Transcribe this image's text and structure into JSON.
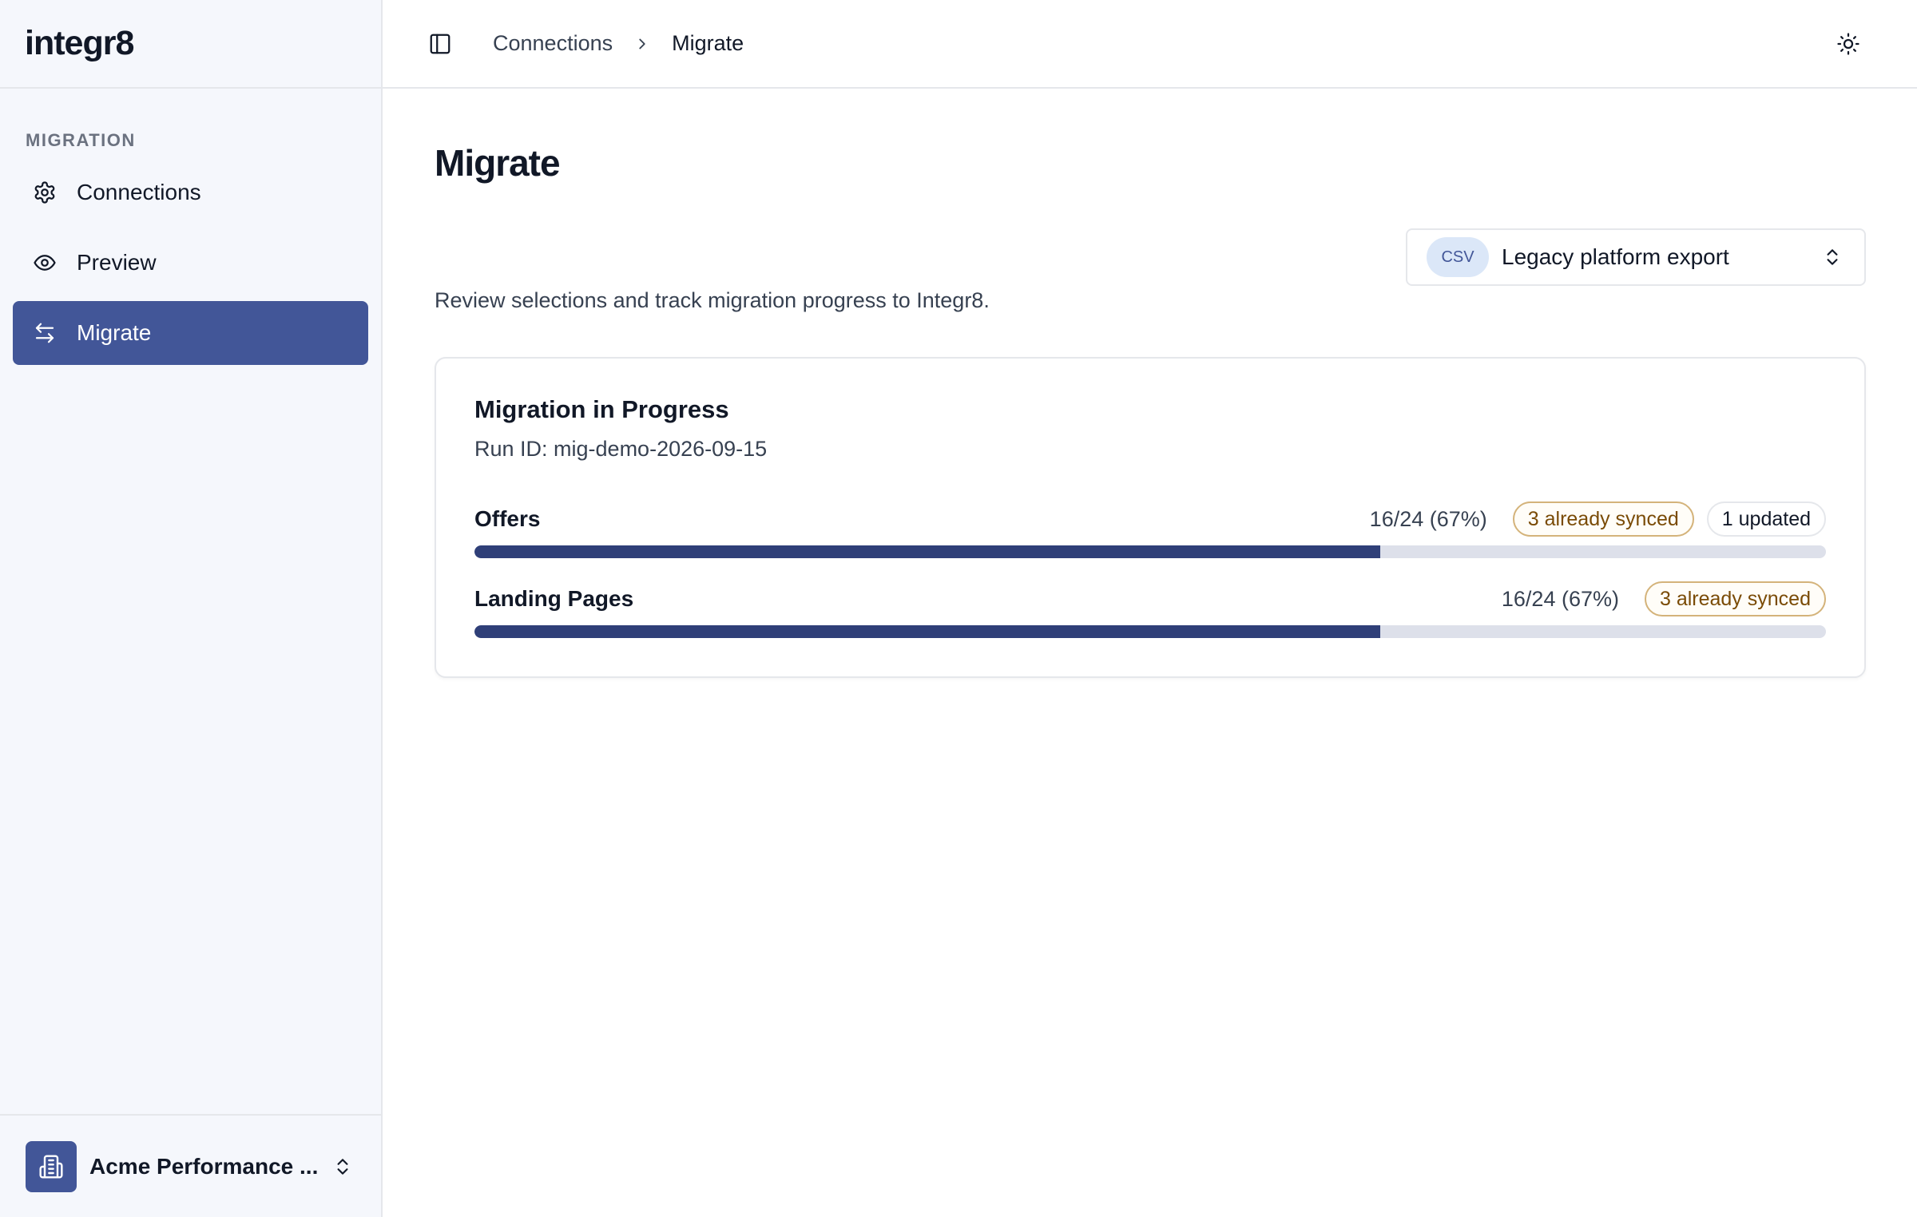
{
  "brand": {
    "logo": "integr8"
  },
  "sidebar": {
    "section_label": "MIGRATION",
    "items": [
      {
        "label": "Connections",
        "icon": "gear-icon",
        "active": false
      },
      {
        "label": "Preview",
        "icon": "eye-icon",
        "active": false
      },
      {
        "label": "Migrate",
        "icon": "arrows-left-right-icon",
        "active": true
      }
    ],
    "org": {
      "name": "Acme Performance ...",
      "icon": "building-icon"
    }
  },
  "topbar": {
    "breadcrumb": [
      "Connections",
      "Migrate"
    ],
    "theme_icon": "sun-icon",
    "panel_icon": "sidebar-panel-icon"
  },
  "page": {
    "title": "Migrate",
    "subtitle": "Review selections and track migration progress to Integr8."
  },
  "source_select": {
    "badge": "CSV",
    "value": "Legacy platform export"
  },
  "progress_card": {
    "title": "Migration in Progress",
    "run_id": "Run ID: mig-demo-2026-09-15",
    "items": [
      {
        "name": "Offers",
        "count": "16/24 (67%)",
        "fraction": 0.67,
        "synced": "3 already synced",
        "updated": "1 updated"
      },
      {
        "name": "Landing Pages",
        "count": "16/24 (67%)",
        "fraction": 0.67,
        "synced": "3 already synced"
      }
    ]
  },
  "colors": {
    "accent": "#425698",
    "bar_fill": "#2f3f78",
    "bar_track": "#dde0ea",
    "sidebar_bg": "#f5f7fc"
  }
}
